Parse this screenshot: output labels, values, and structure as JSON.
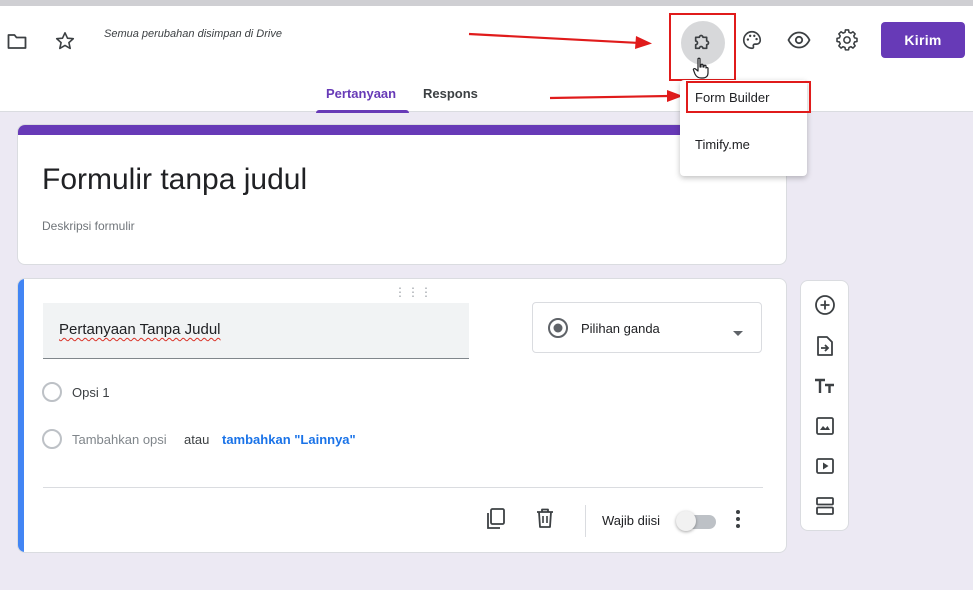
{
  "header": {
    "save_status": "Semua perubahan disimpan di Drive",
    "send_label": "Kirim",
    "icons": [
      "folder-icon",
      "star-icon",
      "puzzle-addon-icon",
      "palette-icon",
      "eye-preview-icon",
      "gear-settings-icon"
    ]
  },
  "tabs": {
    "questions": "Pertanyaan",
    "responses": "Respons"
  },
  "addon_menu": {
    "items": [
      "Form Builder",
      "Timify.me"
    ]
  },
  "form": {
    "title": "Formulir tanpa judul",
    "description": "Deskripsi formulir"
  },
  "question": {
    "title": "Pertanyaan Tanpa Judul",
    "type": "Pilihan ganda",
    "option1": "Opsi 1",
    "add_option": "Tambahkan opsi",
    "or": "atau",
    "add_other": "tambahkan \"Lainnya\"",
    "required_label": "Wajib diisi",
    "required": false
  },
  "colors": {
    "accent": "#673ab7",
    "highlight_box": "#e01b1b",
    "question_accent": "#4285f4"
  }
}
